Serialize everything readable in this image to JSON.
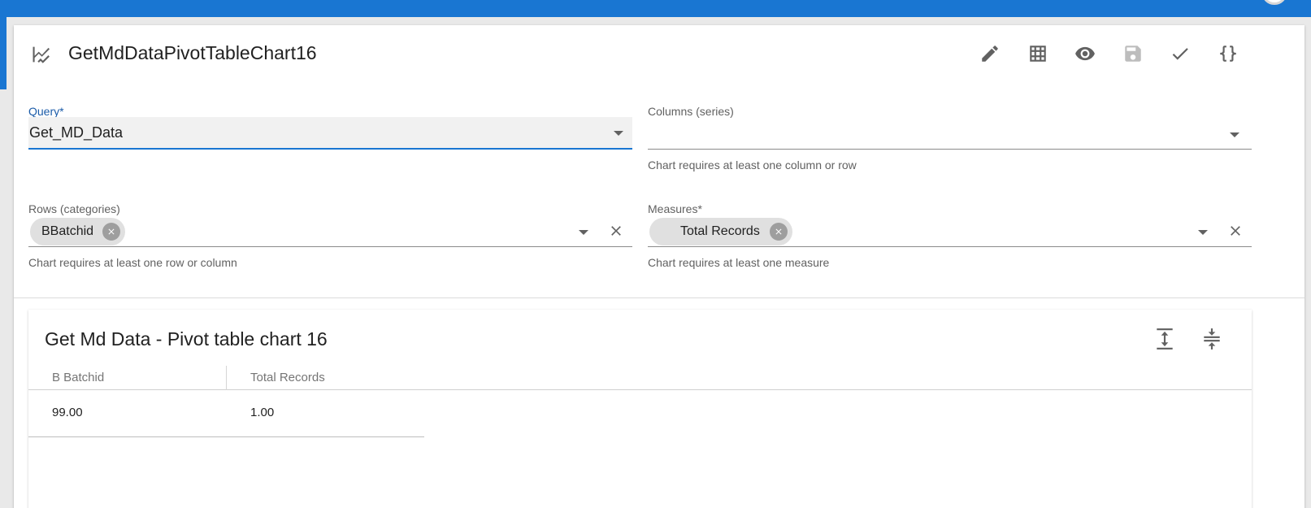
{
  "header": {
    "title": "GetMdDataPivotTableChart16",
    "icon": "chart-line-icon"
  },
  "toolbar": {
    "icons": [
      "edit-icon",
      "table-icon",
      "preview-icon",
      "save-icon",
      "check-icon",
      "json-icon"
    ]
  },
  "form": {
    "query": {
      "label": "Query*",
      "value": "Get_MD_Data"
    },
    "columns": {
      "label": "Columns (series)",
      "value": "",
      "hint": "Chart requires at least one column or row"
    },
    "rows": {
      "label": "Rows (categories)",
      "chips": [
        "BBatchid"
      ],
      "hint": "Chart requires at least one row or column"
    },
    "measures": {
      "label": "Measures*",
      "chips": [
        "Total Records"
      ],
      "hint": "Chart requires at least one measure"
    }
  },
  "result": {
    "title": "Get Md Data - Pivot table chart 16",
    "table": {
      "headers": [
        "B Batchid",
        "Total Records"
      ],
      "rows": [
        [
          "99.00",
          "1.00"
        ]
      ]
    }
  },
  "colors": {
    "accent": "#1976d2",
    "focused_label": "#1a5ba8",
    "icon": "#616161",
    "disabled_icon": "#bdbdbd",
    "chip": "#e0e0e0"
  }
}
